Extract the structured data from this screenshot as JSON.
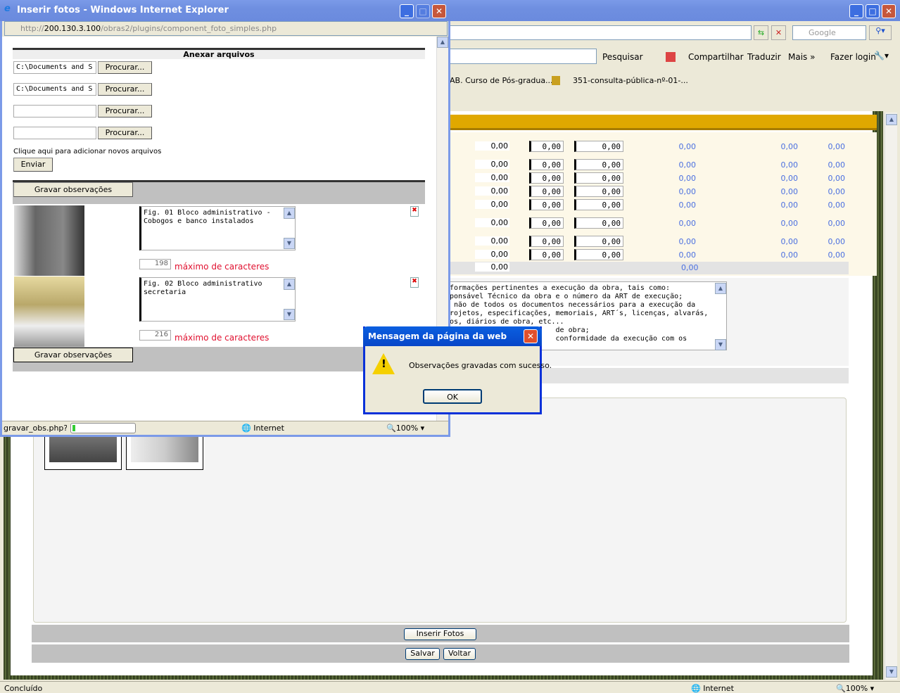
{
  "main_window": {
    "search_placeholder": "Google",
    "toolbar": {
      "search": "Pesquisar",
      "share": "Compartilhar",
      "translate": "Traduzir",
      "more": "Mais »",
      "login": "Fazer login"
    },
    "favorites": [
      "AB. Curso de Pós-gradua...",
      "351-consulta-pública-nº-01-..."
    ],
    "header_color": "#e0a800",
    "rows": [
      {
        "c1": "0,00",
        "i1": "0,00",
        "i2": "0,00",
        "b1": "0,00",
        "b2": "0,00",
        "b3": "0,00"
      },
      {
        "c1": "0,00",
        "i1": "0,00",
        "i2": "0,00",
        "b1": "0,00",
        "b2": "0,00",
        "b3": "0,00"
      },
      {
        "c1": "0,00",
        "i1": "0,00",
        "i2": "0,00",
        "b1": "0,00",
        "b2": "0,00",
        "b3": "0,00"
      },
      {
        "c1": "0,00",
        "i1": "0,00",
        "i2": "0,00",
        "b1": "0,00",
        "b2": "0,00",
        "b3": "0,00"
      },
      {
        "c1": "0,00",
        "i1": "0,00",
        "i2": "0,00",
        "b1": "0,00",
        "b2": "0,00",
        "b3": "0,00"
      },
      {
        "c1": "0,00",
        "i1": "0,00",
        "i2": "0,00",
        "b1": "0,00",
        "b2": "0,00",
        "b3": "0,00"
      },
      {
        "c1": "0,00",
        "i1": "0,00",
        "i2": "0,00",
        "b1": "0,00",
        "b2": "0,00",
        "b3": "0,00"
      },
      {
        "c1": "0,00",
        "i1": "0,00",
        "i2": "0,00",
        "b1": "0,00",
        "b2": "0,00",
        "b3": "0,00"
      }
    ],
    "total": {
      "c1": "0,00",
      "b1": "0,00"
    },
    "observations_text": "formações pertinentes a execução da obra, tais como:\nponsável Técnico da obra e o número da ART de execução;\n não de todos os documentos necessários para a execução da\nrojetos, especificações, memoriais, ART´s, licenças, alvarás,\nos, diários de obra, etc...\n                         de obra;\n                         conformidade da execução com os",
    "insert_photos": "Inserir Fotos",
    "save": "Salvar",
    "back": "Voltar",
    "status": {
      "text": "Concluído",
      "zone": "Internet",
      "zoom": "100%"
    }
  },
  "popup": {
    "title": "Inserir fotos - Windows Internet Explorer",
    "url_prefix": "http://",
    "url_host": "200.130.3.100",
    "url_path": "/obras2/plugins/component_foto_simples.php",
    "attach_header": "Anexar arquivos",
    "files": [
      "C:\\Documents and S",
      "C:\\Documents and S",
      "",
      ""
    ],
    "browse": "Procurar...",
    "add_more": "Clique aqui para adicionar novos arquivos",
    "send": "Enviar",
    "save_obs": "Gravar observações",
    "photos": [
      {
        "caption": "Fig. 01 Bloco administrativo -\nCobogos e banco instalados",
        "remaining": "198"
      },
      {
        "caption": "Fig. 02 Bloco administrativo\nsecretaria",
        "remaining": "216"
      }
    ],
    "max_chars": "máximo de caracteres",
    "status": {
      "text": "gravar_obs.php?fu",
      "zone": "Internet",
      "zoom": "100%",
      "progress": 0.05
    }
  },
  "dialog": {
    "title": "Mensagem da página da web",
    "message": "Observações gravadas com sucesso.",
    "ok": "OK"
  }
}
